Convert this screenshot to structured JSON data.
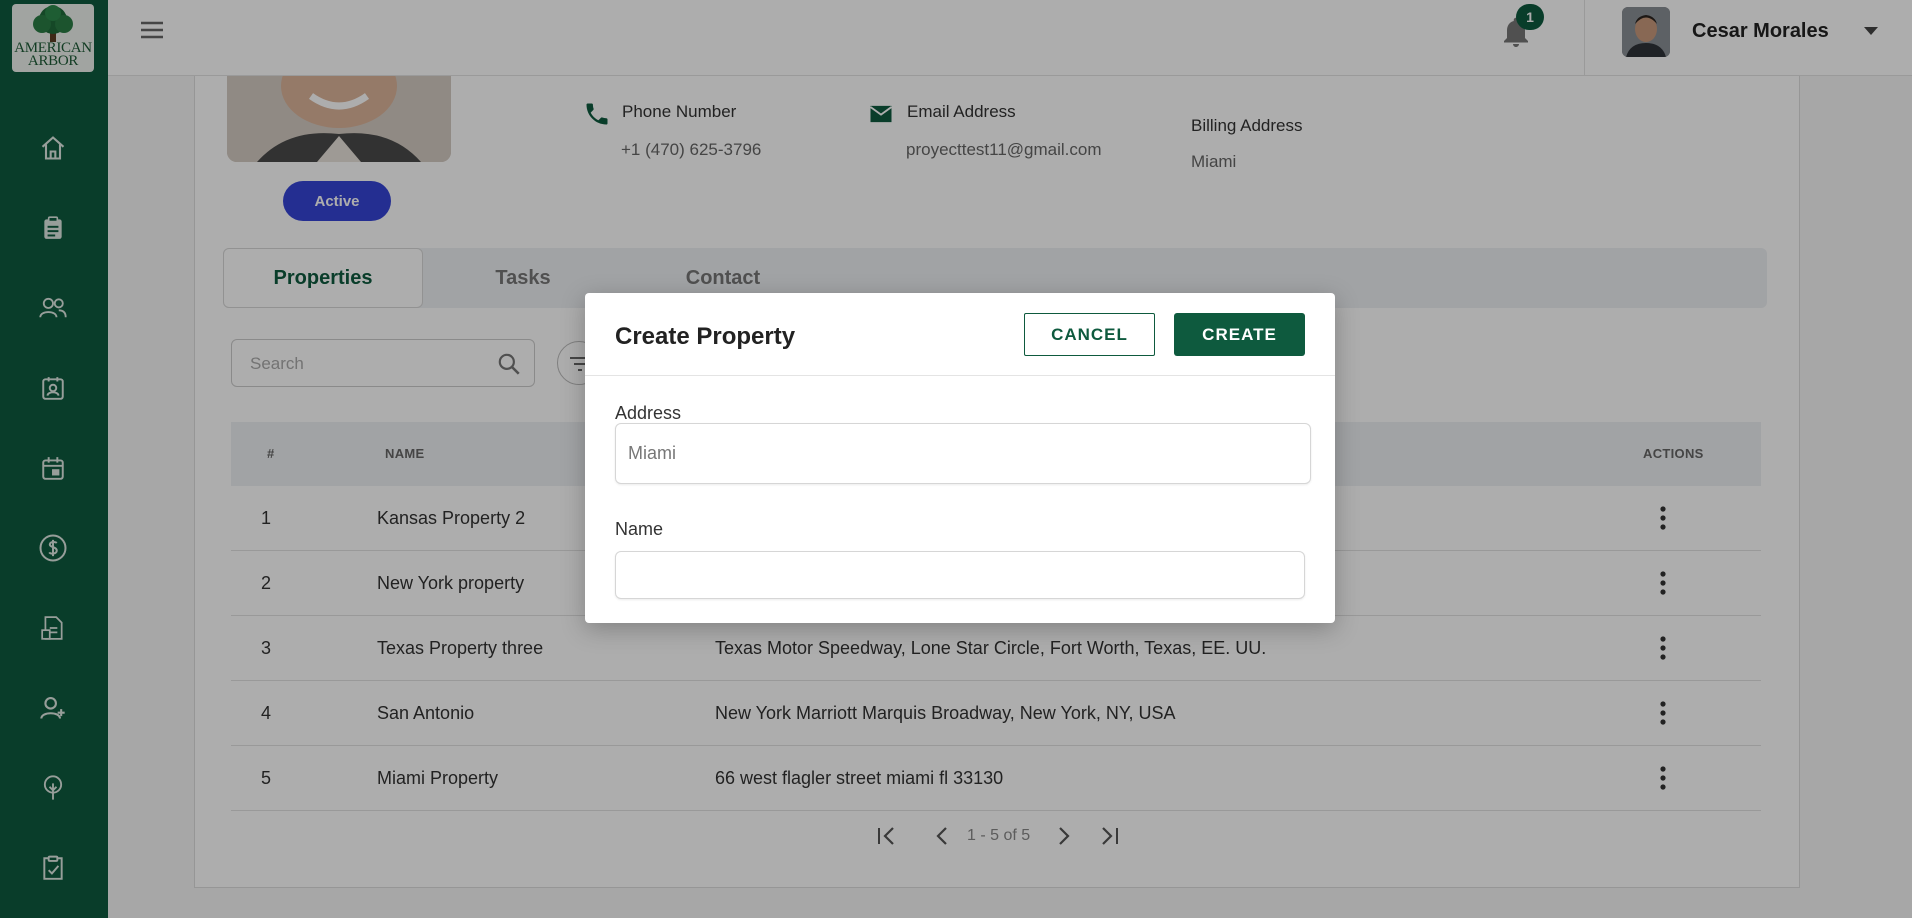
{
  "app": {
    "logo_line1": "AMERICAN",
    "logo_line2": "ARBOR"
  },
  "sidebar": {
    "items": [
      {
        "icon": "home-icon"
      },
      {
        "icon": "clipboard-icon"
      },
      {
        "icon": "users-icon"
      },
      {
        "icon": "contact-card-icon"
      },
      {
        "icon": "calendar-icon"
      },
      {
        "icon": "dollar-icon"
      },
      {
        "icon": "invoice-icon"
      },
      {
        "icon": "add-user-icon"
      },
      {
        "icon": "tree-icon"
      },
      {
        "icon": "checklist-icon"
      }
    ]
  },
  "header": {
    "notification_count": "1",
    "user_name": "Cesar Morales"
  },
  "profile": {
    "status": "Active",
    "phone_label": "Phone Number",
    "phone_value": "+1 (470) 625-3796",
    "email_label": "Email Address",
    "email_value": "proyecttest11@gmail.com",
    "billing_label": "Billing Address",
    "billing_value": "Miami"
  },
  "tabs": [
    {
      "label": "Properties",
      "active": true
    },
    {
      "label": "Tasks",
      "active": false
    },
    {
      "label": "Contact",
      "active": false
    }
  ],
  "search": {
    "placeholder": "Search"
  },
  "table": {
    "columns": [
      "#",
      "NAME",
      "ACTIONS"
    ],
    "rows": [
      {
        "num": "1",
        "name": "Kansas Property 2",
        "address": ""
      },
      {
        "num": "2",
        "name": "New York property",
        "address": ""
      },
      {
        "num": "3",
        "name": "Texas Property three",
        "address": "Texas Motor Speedway, Lone Star Circle, Fort Worth, Texas, EE. UU."
      },
      {
        "num": "4",
        "name": "San Antonio",
        "address": "New York Marriott Marquis Broadway, New York, NY, USA"
      },
      {
        "num": "5",
        "name": "Miami Property",
        "address": "66 west flagler street miami fl 33130"
      }
    ]
  },
  "pagination": {
    "range": "1 - 5 of 5"
  },
  "modal": {
    "title": "Create Property",
    "cancel_label": "CANCEL",
    "create_label": "CREATE",
    "address_label": "Address",
    "address_value": "Miami",
    "name_label": "Name",
    "name_value": ""
  },
  "colors": {
    "brand_green": "#0e5a3e",
    "active_pill": "#3545d6"
  }
}
